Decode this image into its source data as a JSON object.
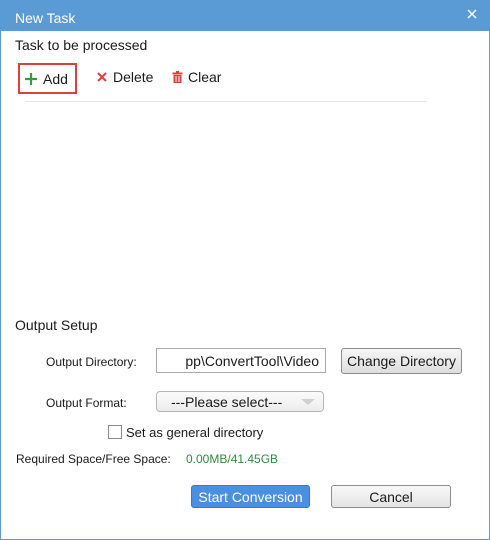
{
  "window": {
    "title": "New Task",
    "close_icon": "close-icon"
  },
  "tasks": {
    "section_label": "Task to be processed",
    "toolbar": {
      "add_label": "Add",
      "delete_label": "Delete",
      "clear_label": "Clear"
    },
    "items": []
  },
  "output": {
    "section_label": "Output Setup",
    "directory_label": "Output Directory:",
    "directory_value": "pp\\ConvertTool\\Video",
    "change_directory_label": "Change Directory",
    "format_label": "Output Format:",
    "format_selected": "---Please select---",
    "general_directory_label": "Set as general directory",
    "general_directory_checked": false,
    "space_label": "Required Space/Free Space:",
    "space_value": "0.00MB/41.45GB"
  },
  "actions": {
    "start_label": "Start Conversion",
    "cancel_label": "Cancel"
  },
  "colors": {
    "titlebar": "#5b9bd5",
    "add_icon": "#2e9e3e",
    "delete_icon": "#e0403a",
    "clear_icon": "#e0403a",
    "space_value": "#2e8b3d",
    "primary_button": "#4a90e2"
  }
}
